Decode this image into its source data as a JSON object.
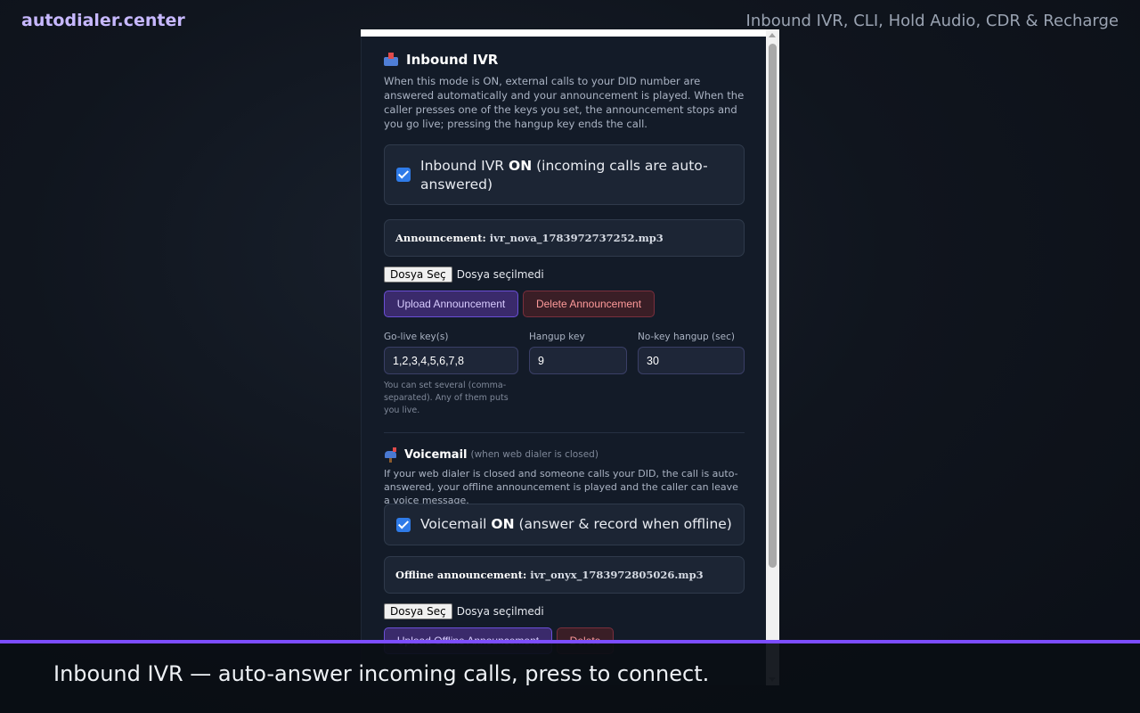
{
  "brand": "autodialer.center",
  "topic": "Inbound IVR, CLI, Hold Audio, CDR & Recharge",
  "ivr": {
    "title": "Inbound IVR",
    "description": "When this mode is ON, external calls to your DID number are answered automatically and your announcement is played. When the caller presses one of the keys you set, the announcement stops and you go live; pressing the hangup key ends the call.",
    "toggle_prefix": "Inbound IVR ",
    "toggle_strong": "ON",
    "toggle_suffix": " (incoming calls are auto-answered)",
    "announcement_label": "Announcement:",
    "announcement_value": "ivr_nova_1783972737252.mp3",
    "file_button": "Dosya Seç",
    "file_status": "Dosya seçilmedi",
    "upload_button": "Upload Announcement",
    "delete_button": "Delete Announcement",
    "golive_label": "Go-live key(s)",
    "golive_value": "1,2,3,4,5,6,7,8",
    "golive_hint": "You can set several (comma-separated). Any of them puts you live.",
    "hangup_label": "Hangup key",
    "hangup_value": "9",
    "nokey_label": "No-key hangup (sec)",
    "nokey_value": "30"
  },
  "voicemail": {
    "title": "Voicemail",
    "subtitle": "(when web dialer is closed)",
    "description": "If your web dialer is closed and someone calls your DID, the call is auto-answered, your offline announcement is played and the caller can leave a voice message.",
    "toggle_prefix": "Voicemail ",
    "toggle_strong": "ON",
    "toggle_suffix": " (answer & record when offline)",
    "announcement_label": "Offline announcement:",
    "announcement_value": "ivr_onyx_1783972805026.mp3",
    "file_button": "Dosya Seç",
    "file_status": "Dosya seçilmedi",
    "upload_button": "Upload Offline Announcement",
    "delete_button": "Delete"
  },
  "caption": "Inbound IVR — auto-answer incoming calls, press to connect.",
  "colors": {
    "accent": "#7c4dff",
    "brand": "#c7b8ff",
    "checkbox": "#2f7be8",
    "delete": "#ff9a9a"
  }
}
